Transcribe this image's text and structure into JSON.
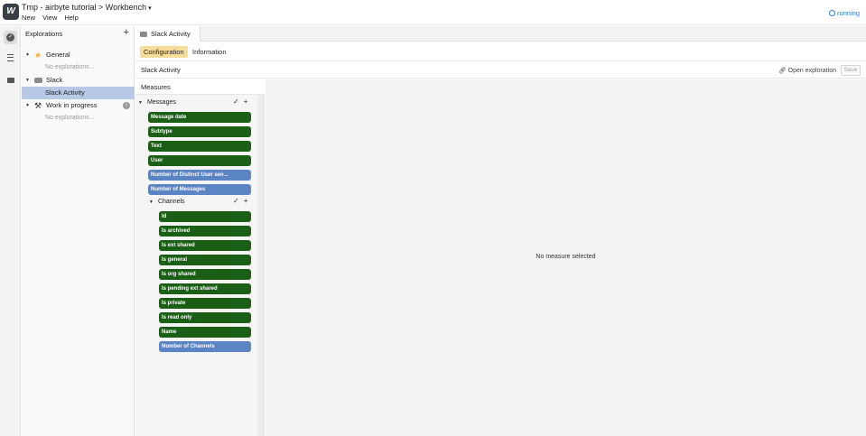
{
  "header": {
    "logo_text": "W",
    "title": "Tmp - airbyte tutorial > Workbench",
    "title_caret": "▾",
    "menu": [
      "New",
      "View",
      "Help"
    ],
    "status": "running",
    "status_color": "#2b7bd1"
  },
  "rail": {
    "items": [
      "explorations-icon",
      "list-icon",
      "card-icon"
    ]
  },
  "explorations": {
    "heading": "Explorations",
    "add": "+",
    "tree": [
      {
        "label": "General",
        "icon": "star-icon",
        "expanded": true
      },
      {
        "label": "No explorations...",
        "muted": true
      },
      {
        "label": "Slack",
        "icon": "slack-icon",
        "expanded": true
      },
      {
        "label": "Slack Activity",
        "selected": true
      },
      {
        "label": "Work in progress",
        "icon": "tools-icon",
        "expanded": true,
        "info": "i"
      },
      {
        "label": "No explorations...",
        "muted": true
      }
    ]
  },
  "main": {
    "tab": "Slack Activity",
    "subtabs": [
      "Configuration",
      "Information"
    ],
    "exploration_title": "Slack Activity",
    "open_exploration": "Open exploration",
    "save": "Save",
    "empty_message": "No measure selected"
  },
  "measures": {
    "heading": "Measures",
    "messages_group": "Messages",
    "messages_fields": [
      {
        "label": "Message date",
        "kind": "dimension"
      },
      {
        "label": "Subtype",
        "kind": "dimension"
      },
      {
        "label": "Text",
        "kind": "dimension"
      },
      {
        "label": "User",
        "kind": "dimension"
      },
      {
        "label": "Number of Distinct User sen...",
        "kind": "measure"
      },
      {
        "label": "Number of Messages",
        "kind": "measure"
      }
    ],
    "channels_group": "Channels",
    "channels_fields": [
      {
        "label": "Id",
        "kind": "dimension"
      },
      {
        "label": "Is archived",
        "kind": "dimension"
      },
      {
        "label": "Is ext shared",
        "kind": "dimension"
      },
      {
        "label": "Is general",
        "kind": "dimension"
      },
      {
        "label": "Is org shared",
        "kind": "dimension"
      },
      {
        "label": "Is pending ext shared",
        "kind": "dimension"
      },
      {
        "label": "Is private",
        "kind": "dimension"
      },
      {
        "label": "Is read only",
        "kind": "dimension"
      },
      {
        "label": "Name",
        "kind": "dimension"
      },
      {
        "label": "Number of Channels",
        "kind": "measure"
      }
    ],
    "colors": {
      "dimension": "#1b5e15",
      "measure": "#5b84c4"
    }
  }
}
